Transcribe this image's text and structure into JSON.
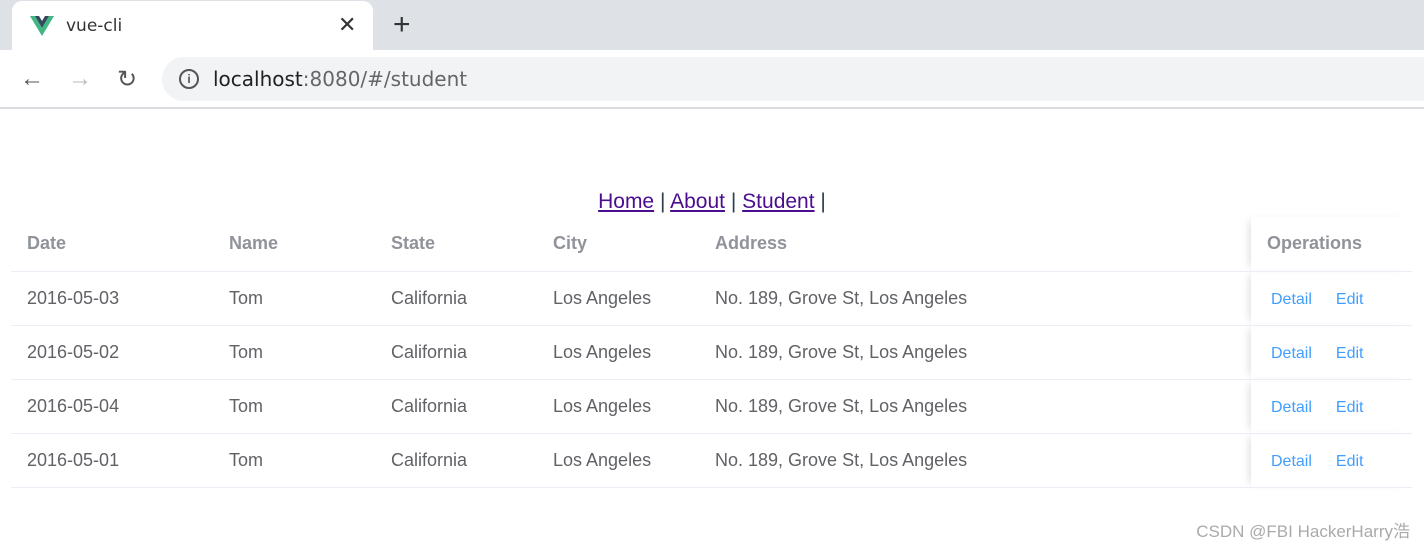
{
  "browser": {
    "tab_title": "vue-cli",
    "url_host": "localhost",
    "url_rest": ":8080/#/student"
  },
  "nav": {
    "links": [
      "Home",
      "About",
      "Student"
    ],
    "sep": "|"
  },
  "table": {
    "columns": [
      "Date",
      "Name",
      "State",
      "City",
      "Address",
      "Operations"
    ],
    "rows": [
      [
        "2016-05-03",
        "Tom",
        "California",
        "Los Angeles",
        "No. 189, Grove St, Los Angeles"
      ],
      [
        "2016-05-02",
        "Tom",
        "California",
        "Los Angeles",
        "No. 189, Grove St, Los Angeles"
      ],
      [
        "2016-05-04",
        "Tom",
        "California",
        "Los Angeles",
        "No. 189, Grove St, Los Angeles"
      ],
      [
        "2016-05-01",
        "Tom",
        "California",
        "Los Angeles",
        "No. 189, Grove St, Los Angeles"
      ]
    ],
    "actions": [
      "Detail",
      "Edit"
    ]
  },
  "watermark": "CSDN @FBI HackerHarry浩",
  "colors": {
    "link": "#409eff",
    "header_text": "#909399",
    "cell_text": "#606266"
  }
}
